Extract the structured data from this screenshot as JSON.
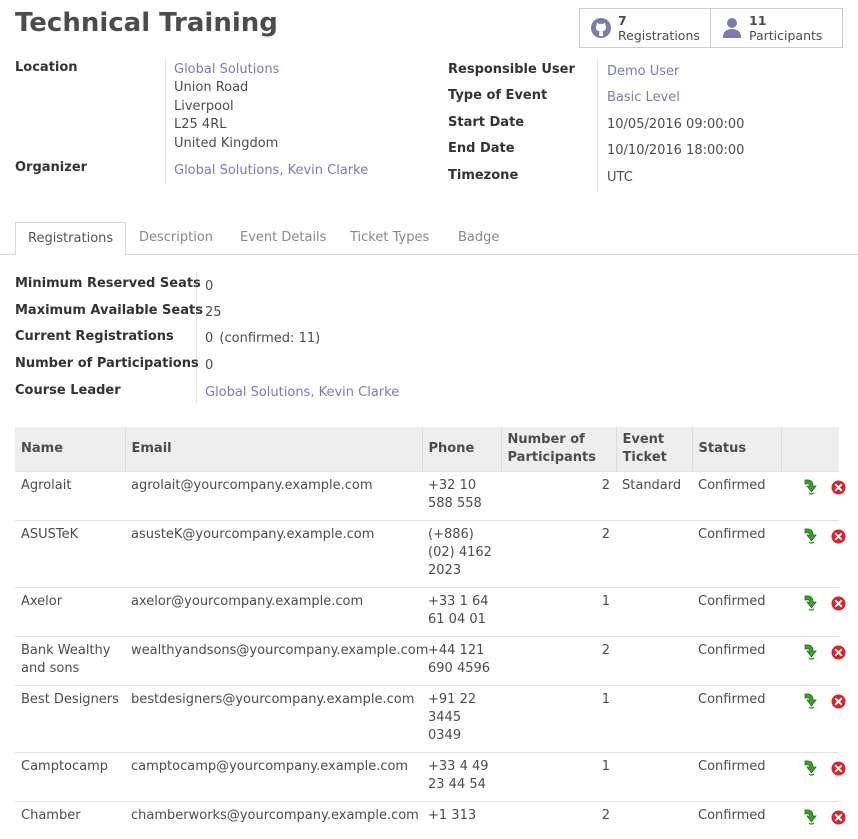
{
  "header": {
    "title": "Technical Training"
  },
  "stats": {
    "registrations": {
      "count": "7",
      "label": "Registrations"
    },
    "participants": {
      "count": "11",
      "label": "Participants"
    }
  },
  "info_left": {
    "location_label": "Location",
    "location_name": "Global Solutions",
    "location_lines": [
      "Union Road",
      "Liverpool",
      "L25 4RL",
      "United Kingdom"
    ],
    "organizer_label": "Organizer",
    "organizer_value": "Global Solutions, Kevin Clarke"
  },
  "info_right": {
    "responsible_label": "Responsible User",
    "responsible_value": "Demo User",
    "type_label": "Type of Event",
    "type_value": "Basic Level",
    "start_label": "Start Date",
    "start_value": "10/05/2016 09:00:00",
    "end_label": "End Date",
    "end_value": "10/10/2016 18:00:00",
    "tz_label": "Timezone",
    "tz_value": "UTC"
  },
  "tabs": [
    "Registrations",
    "Description",
    "Event Details",
    "Ticket Types",
    "Badge"
  ],
  "seats": {
    "min_label": "Minimum Reserved Seats",
    "min_value": "0",
    "max_label": "Maximum Available Seats",
    "max_value": "25",
    "current_label": "Current Registrations",
    "current_value": "0",
    "current_confirmed_prefix": "(confirmed:",
    "current_confirmed_value": "11",
    "current_confirmed_suffix": ")",
    "participations_label": "Number of Participations",
    "participations_value": "0",
    "leader_label": "Course Leader",
    "leader_value": "Global Solutions, Kevin Clarke"
  },
  "table": {
    "headers": [
      "Name",
      "Email",
      "Phone",
      "Number of Participants",
      "Event Ticket",
      "Status"
    ],
    "rows": [
      {
        "name": "Agrolait",
        "email": "agrolait@yourcompany.example.com",
        "phone": "+32 10 588 558",
        "participants": "2",
        "ticket": "Standard",
        "status": "Confirmed"
      },
      {
        "name": "ASUSTeK",
        "email": "asusteK@yourcompany.example.com",
        "phone": "(+886) (02) 4162 2023",
        "participants": "2",
        "ticket": "",
        "status": "Confirmed"
      },
      {
        "name": "Axelor",
        "email": "axelor@yourcompany.example.com",
        "phone": "+33 1 64 61 04 01",
        "participants": "1",
        "ticket": "",
        "status": "Confirmed"
      },
      {
        "name": "Bank Wealthy and sons",
        "email": "wealthyandsons@yourcompany.example.com",
        "phone": "+44 121 690 4596",
        "participants": "2",
        "ticket": "",
        "status": "Confirmed"
      },
      {
        "name": "Best Designers",
        "email": "bestdesigners@yourcompany.example.com",
        "phone": "+91 22 3445 0349",
        "participants": "1",
        "ticket": "",
        "status": "Confirmed"
      },
      {
        "name": "Camptocamp",
        "email": "camptocamp@yourcompany.example.com",
        "phone": "+33 4 49 23 44 54",
        "participants": "1",
        "ticket": "",
        "status": "Confirmed"
      },
      {
        "name": "Chamber",
        "email": "chamberworks@yourcompany.example.com",
        "phone": "+1 313",
        "participants": "2",
        "ticket": "",
        "status": "Confirmed"
      }
    ]
  },
  "icons": {
    "attended": "green-arrow-down-icon",
    "cancel": "red-cancel-icon"
  },
  "colors": {
    "link": "#7c7bad",
    "attended": "#3aa22b",
    "cancel": "#d9232a"
  }
}
